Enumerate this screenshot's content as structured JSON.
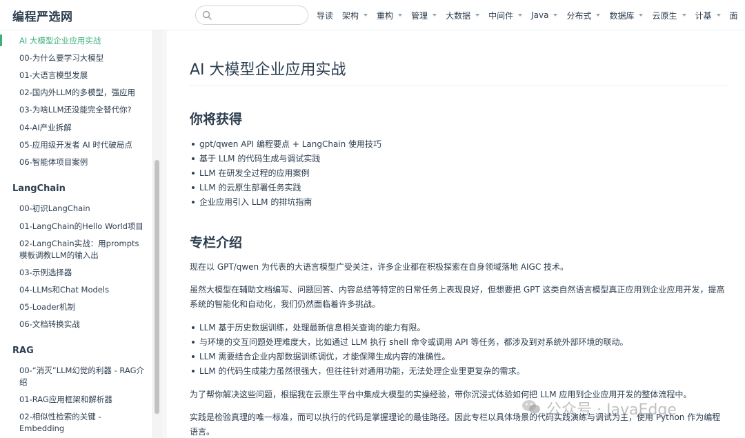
{
  "header": {
    "site_title": "编程严选网",
    "search": {
      "value": "",
      "placeholder": ""
    },
    "nav": [
      {
        "label": "导读",
        "has_dropdown": false
      },
      {
        "label": "架构",
        "has_dropdown": true
      },
      {
        "label": "重构",
        "has_dropdown": true
      },
      {
        "label": "管理",
        "has_dropdown": true
      },
      {
        "label": "大数据",
        "has_dropdown": true
      },
      {
        "label": "中间件",
        "has_dropdown": true
      },
      {
        "label": "Java",
        "has_dropdown": true
      },
      {
        "label": "分布式",
        "has_dropdown": true
      },
      {
        "label": "数据库",
        "has_dropdown": true
      },
      {
        "label": "云原生",
        "has_dropdown": true
      },
      {
        "label": "计基",
        "has_dropdown": true
      },
      {
        "label": "面",
        "has_dropdown": false
      }
    ]
  },
  "sidebar": {
    "groups": [
      {
        "title": "",
        "items": [
          {
            "label": "AI 大模型企业应用实战",
            "active": true
          },
          {
            "label": "00-为什么要学习大模型"
          },
          {
            "label": "01-大语言模型发展"
          },
          {
            "label": "02-国内外LLM的多模型，强应用"
          },
          {
            "label": "03-为啥LLM还没能完全替代你?"
          },
          {
            "label": "04-AI产业拆解"
          },
          {
            "label": "05-应用级开发者 AI 时代破局点"
          },
          {
            "label": "06-智能体项目案例"
          }
        ]
      },
      {
        "title": "LangChain",
        "items": [
          {
            "label": "00-初识LangChain"
          },
          {
            "label": "01-LangChain的Hello World项目"
          },
          {
            "label": "02-LangChain实战：用prompts模板调教LLM的输入出"
          },
          {
            "label": "03-示例选择器"
          },
          {
            "label": "04-LLMs和Chat Models"
          },
          {
            "label": "05-Loader机制"
          },
          {
            "label": "06-文档转换实战"
          }
        ]
      },
      {
        "title": "RAG",
        "items": [
          {
            "label": "00-“消灭”LLM幻觉的利器 - RAG介绍"
          },
          {
            "label": "01-RAG应用框架和解析器"
          },
          {
            "label": "02-相似性检索的关键 - Embedding"
          }
        ]
      }
    ]
  },
  "main": {
    "title": "AI 大模型企业应用实战",
    "section1": {
      "heading": "你将获得",
      "bullets": [
        "gpt/qwen API 编程要点 + LangChain 使用技巧",
        "基于 LLM 的代码生成与调试实践",
        "LLM 在研发全过程的应用案例",
        "LLM 的云原生部署任务实践",
        "企业应用引入 LLM 的排坑指南"
      ]
    },
    "section2": {
      "heading": "专栏介绍",
      "p1": "现在以 GPT/qwen 为代表的大语言模型广受关注，许多企业都在积极探索在自身领域落地 AIGC 技术。",
      "p2": "虽然大模型在辅助文档编写、问题回答、内容总结等特定的日常任务上表现良好，但想要把 GPT 这类自然语言模型真正应用到企业应用开发，提高系统的智能化和自动化，我们仍然面临着许多挑战。",
      "bullets": [
        "LLM 基于历史数据训练，处理最新信息相关查询的能力有限。",
        "与环境的交互问题处理难度大，比如通过 LLM 执行 shell 命令或调用 API 等任务，都涉及到对系统外部环境的联动。",
        "LLM 需要结合企业内部数据训练调优，才能保障生成内容的准确性。",
        "LLM 的代码生成能力虽然很强大，但往往针对通用功能，无法处理企业里更复杂的需求。"
      ],
      "p3": "为了帮你解决这些问题，根据我在云原生平台中集成大模型的实操经验，带你沉浸式体验如何把 LLM 应用到企业应用开发的整体流程中。",
      "p4": "实践是检验真理的唯一标准，而可以执行的代码是掌握理论的最佳路径。因此专栏以具体场景的代码实践演练与调试为主，使用 Python 作为编程语言。"
    }
  },
  "watermark": {
    "text": "公众号 · JavaEdge",
    "icon": "wechat-icon"
  },
  "colors": {
    "accent": "#3eaf7c",
    "text": "#2c3e50",
    "border": "#eaecef"
  }
}
